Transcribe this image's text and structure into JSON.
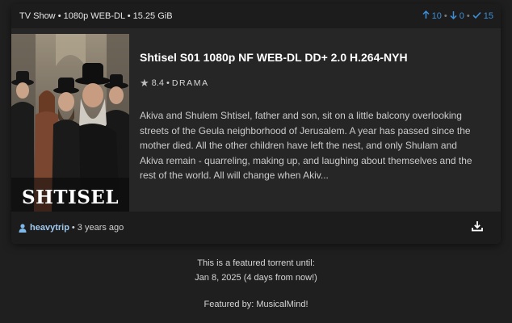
{
  "header": {
    "category": "TV Show",
    "resolution": "1080p",
    "source": "WEB-DL",
    "size": "15.25 GiB",
    "separator": "•",
    "seeders_icon": "arrow-up-icon",
    "seeders": "10",
    "leechers_icon": "arrow-down-icon",
    "leechers": "0",
    "completed_icon": "check-icon",
    "completed": "15"
  },
  "poster": {
    "title_text": "SHTISEL"
  },
  "torrent": {
    "name": "Shtisel S01 1080p NF WEB-DL DD+ 2.0 H.264-NYH",
    "rating_icon": "star-icon",
    "rating": "8.4",
    "genre": "DRAMA",
    "description": "Akiva and Shulem Shtisel, father and son, sit on a little balcony overlooking streets of the Geula neighborhood of Jerusalem. A year has passed since the mother died. All the other children have left the nest, and only Shulam and Akiva remain - quarreling, making up, and laughing about themselves and the rest of the world. All will change when Akiv..."
  },
  "footer": {
    "uploader_icon": "user-icon",
    "uploader": "heavytrip",
    "age": "3 years ago",
    "download_icon": "download-icon"
  },
  "featured": {
    "line1": "This is a featured torrent until:",
    "line2": "Jan 8, 2025 (4 days from now!)",
    "line3": "Featured by: MusicalMind!"
  },
  "colors": {
    "accent": "#3d8fd6",
    "uploader": "#9fc9ef"
  }
}
